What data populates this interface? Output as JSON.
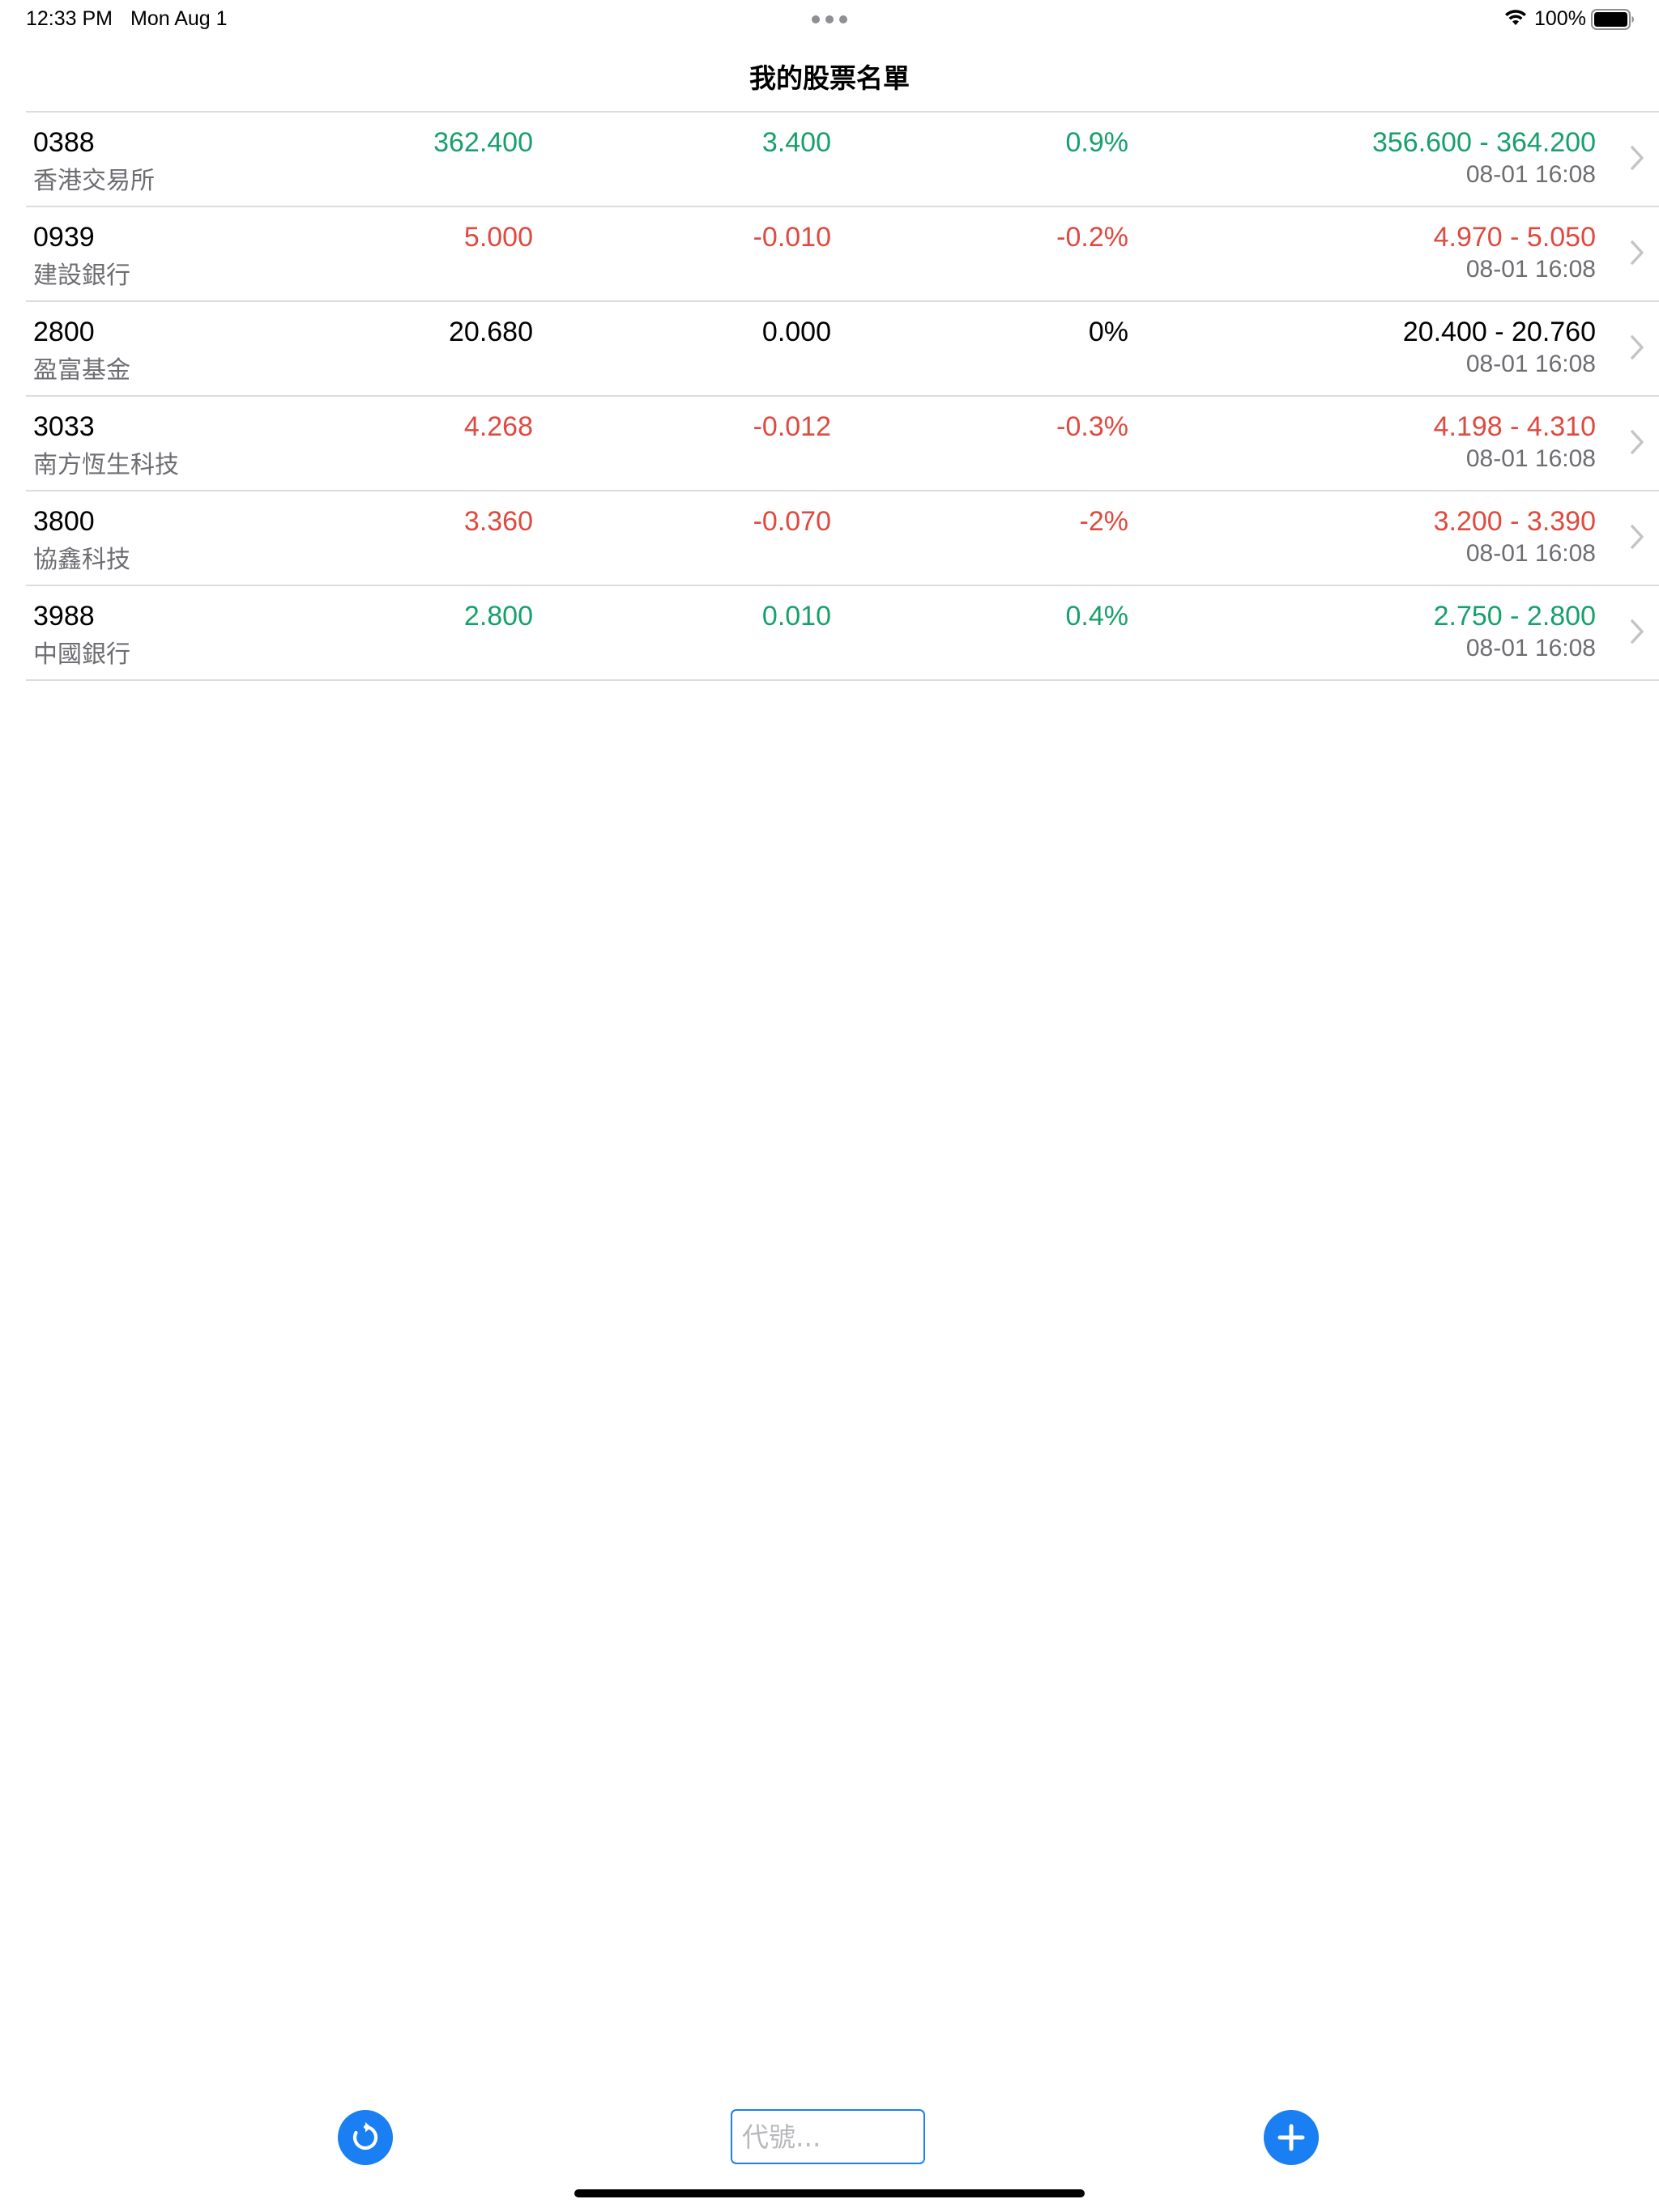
{
  "status_bar": {
    "time": "12:33 PM",
    "date": "Mon Aug 1",
    "battery": "100%"
  },
  "nav": {
    "title": "我的股票名單"
  },
  "colors": {
    "up": "#17a06d",
    "down": "#e0493f",
    "flat": "#000000",
    "accent": "#1a7ff2"
  },
  "stocks": [
    {
      "code": "0388",
      "name": "香港交易所",
      "price": "362.400",
      "change": "3.400",
      "pct": "0.9%",
      "range": "356.600 - 364.200",
      "time": "08-01 16:08",
      "trend": "up"
    },
    {
      "code": "0939",
      "name": "建設銀行",
      "price": "5.000",
      "change": "-0.010",
      "pct": "-0.2%",
      "range": "4.970 - 5.050",
      "time": "08-01 16:08",
      "trend": "down"
    },
    {
      "code": "2800",
      "name": "盈富基金",
      "price": "20.680",
      "change": "0.000",
      "pct": "0%",
      "range": "20.400 - 20.760",
      "time": "08-01 16:08",
      "trend": "flat"
    },
    {
      "code": "3033",
      "name": "南方恆生科技",
      "price": "4.268",
      "change": "-0.012",
      "pct": "-0.3%",
      "range": "4.198 - 4.310",
      "time": "08-01 16:08",
      "trend": "down"
    },
    {
      "code": "3800",
      "name": "協鑫科技",
      "price": "3.360",
      "change": "-0.070",
      "pct": "-2%",
      "range": "3.200 - 3.390",
      "time": "08-01 16:08",
      "trend": "down"
    },
    {
      "code": "3988",
      "name": "中國銀行",
      "price": "2.800",
      "change": "0.010",
      "pct": "0.4%",
      "range": "2.750 - 2.800",
      "time": "08-01 16:08",
      "trend": "up"
    }
  ],
  "toolbar": {
    "refresh_icon": "refresh-icon",
    "add_icon": "plus-icon",
    "code_input_placeholder": "代號...",
    "code_input_value": ""
  }
}
